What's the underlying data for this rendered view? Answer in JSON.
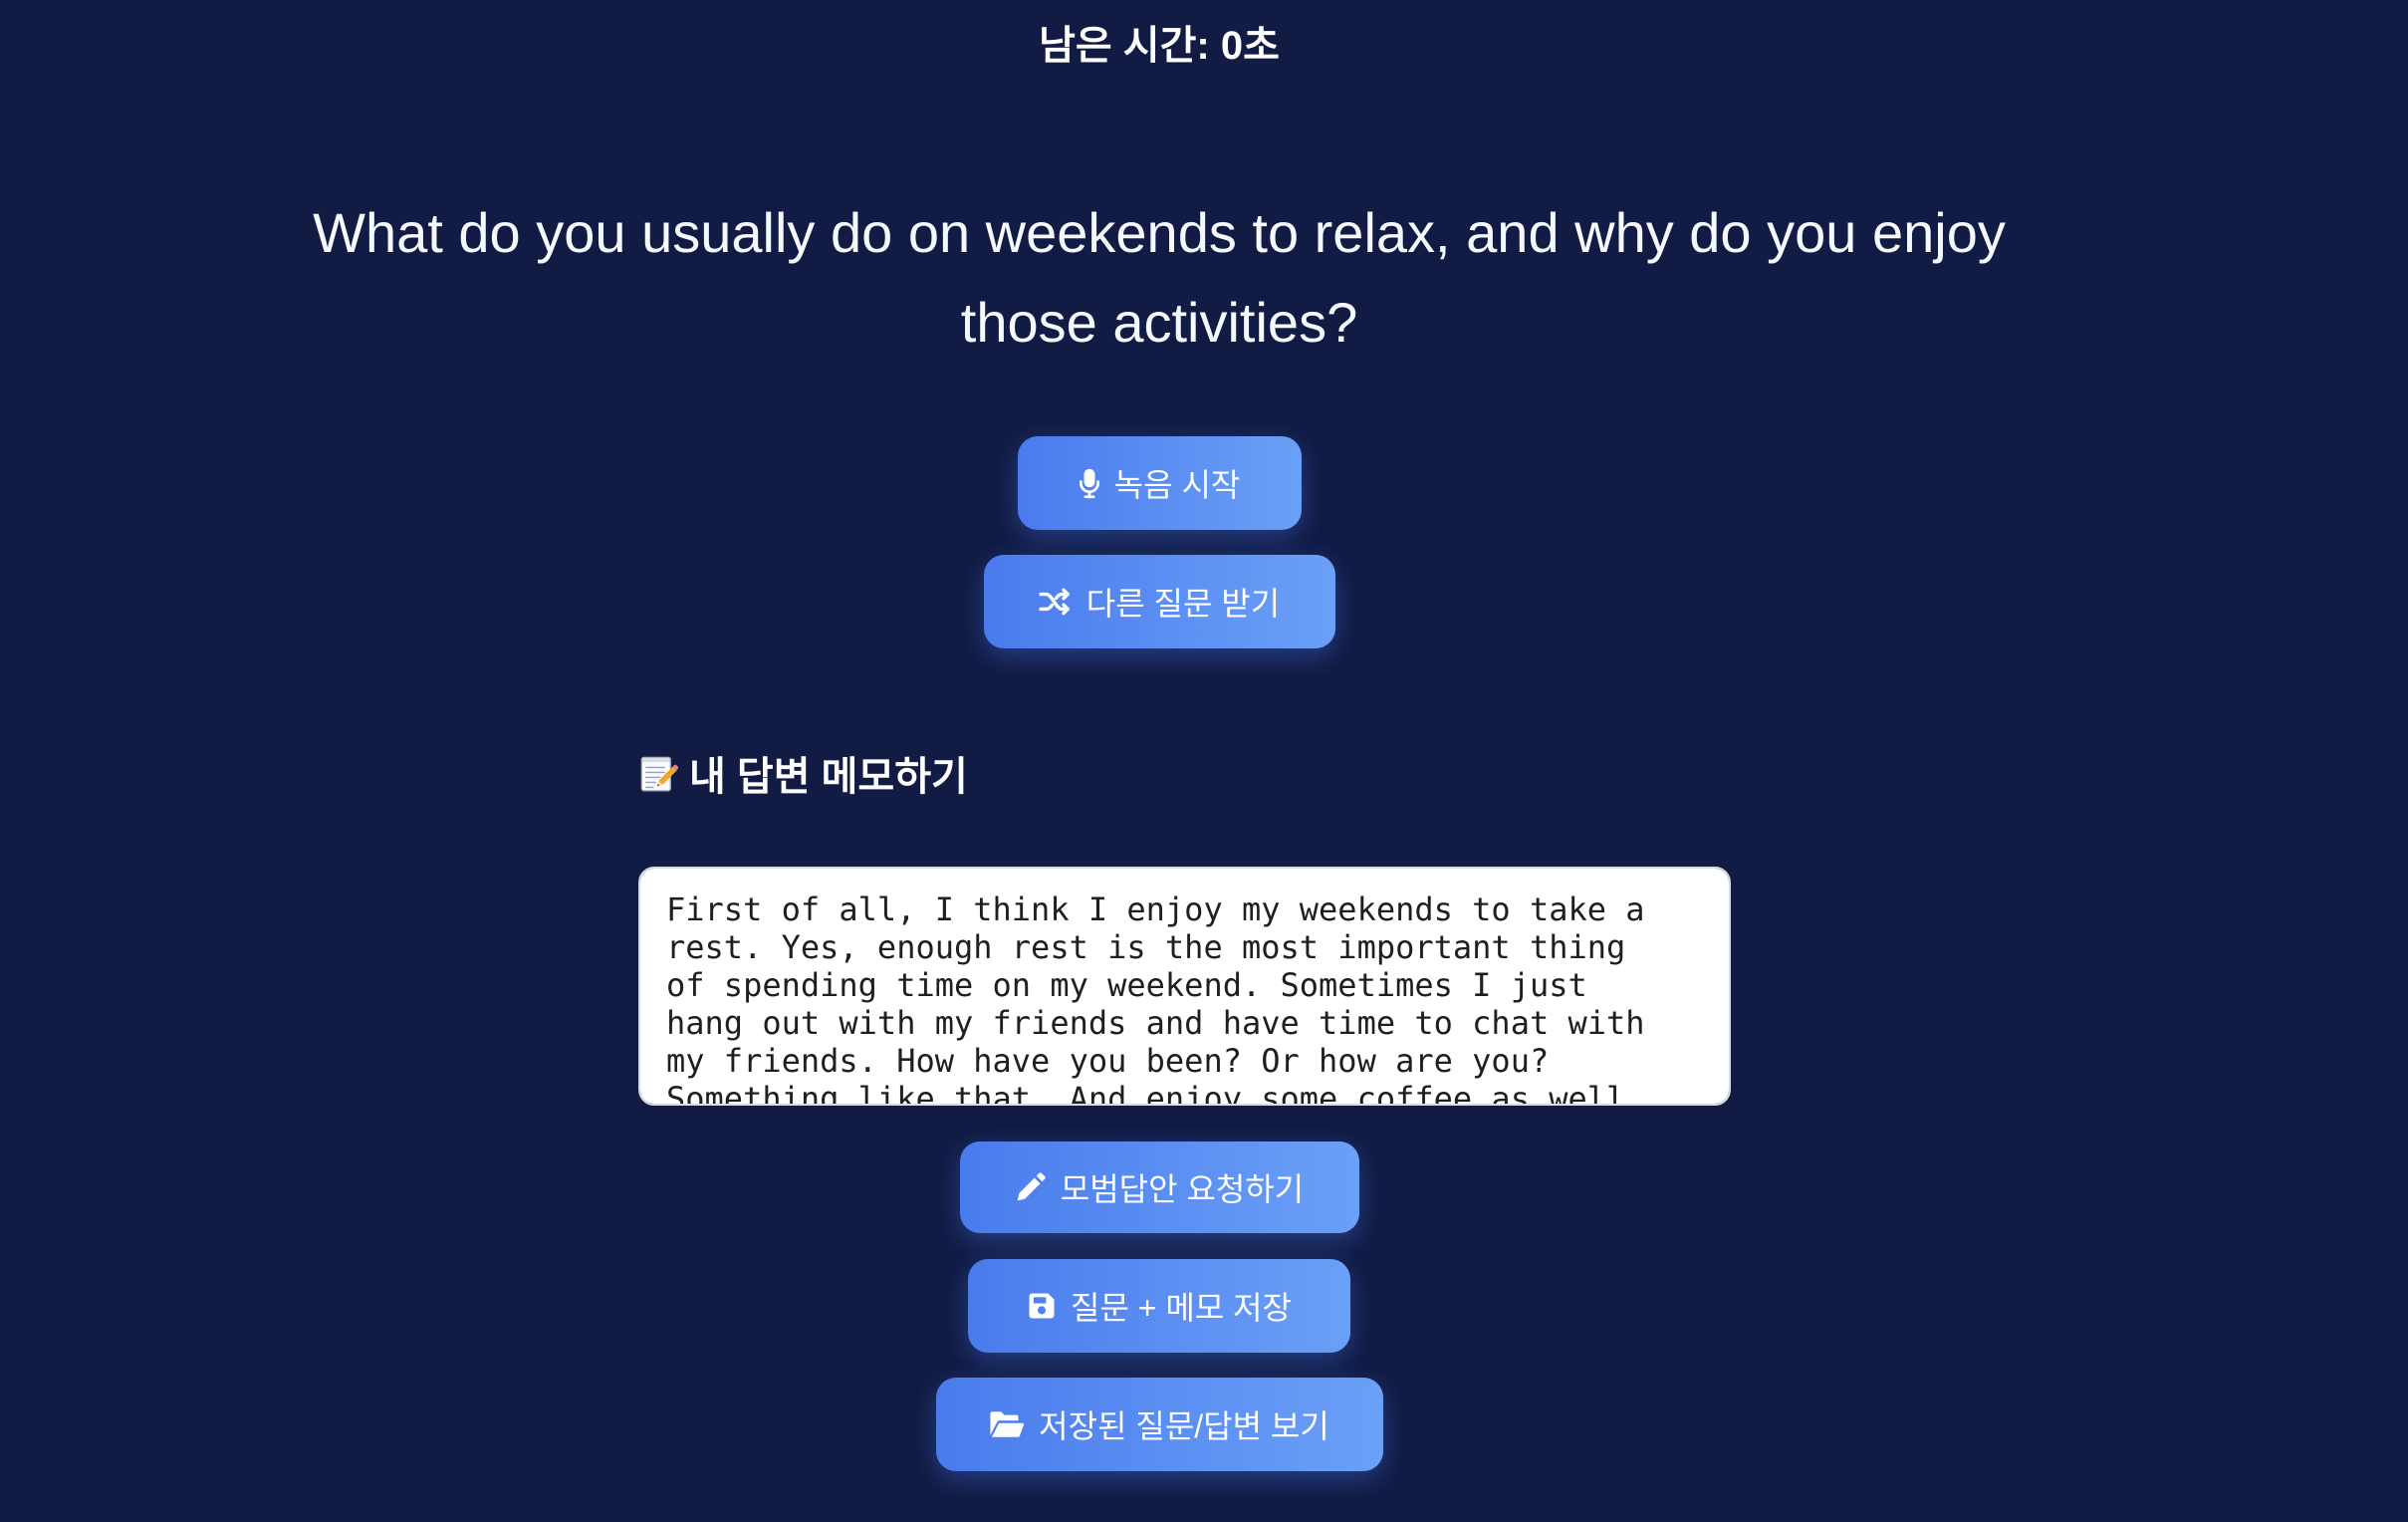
{
  "timer": {
    "text": "남은 시간: 0초"
  },
  "question": {
    "text": "What do you usually do on weekends to relax, and why do you enjoy those activities?"
  },
  "actions_top": {
    "record": {
      "label": "녹음 시작",
      "icon": "microphone-icon"
    },
    "new_question": {
      "label": "다른 질문 받기",
      "icon": "shuffle-icon"
    }
  },
  "memo": {
    "heading": "내 답변 메모하기",
    "heading_icon": "memo-icon",
    "text": "First of all, I think I enjoy my weekends to take a rest. Yes, enough rest is the most important thing of spending time on my weekend. Sometimes I just hang out with my friends and have time to chat with my friends. How have you been? Or how are you? Something like that. And enjoy some coffee as well"
  },
  "actions_bottom": {
    "model_answer": {
      "label": "모범답안 요청하기",
      "icon": "pencil-icon"
    },
    "save": {
      "label": "질문 + 메모 저장",
      "icon": "save-icon"
    },
    "saved_list": {
      "label": "저장된 질문/답변 보기",
      "icon": "folder-open-icon"
    }
  },
  "colors": {
    "background": "#111b44",
    "text": "#ffffff",
    "button_start": "#4a7bed",
    "button_end": "#6ba0f7"
  }
}
